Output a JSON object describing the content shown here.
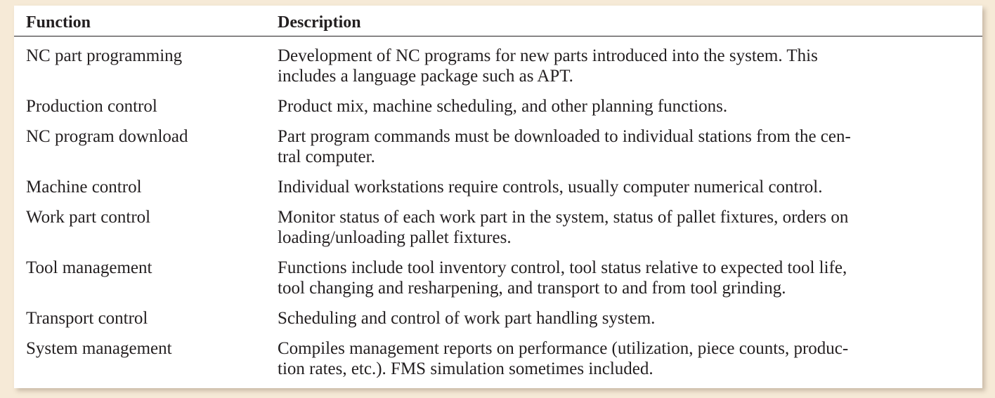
{
  "table": {
    "headers": {
      "function": "Function",
      "description": "Description"
    },
    "rows": [
      {
        "function": "NC part programming",
        "description_lines": [
          "Development of NC programs for new parts introduced into the system. This",
          "includes a language package such as APT."
        ]
      },
      {
        "function": "Production control",
        "description_lines": [
          "Product mix, machine scheduling, and other planning functions."
        ]
      },
      {
        "function": "NC program download",
        "description_lines": [
          "Part program commands must be downloaded to individual stations from the cen-",
          "tral computer."
        ]
      },
      {
        "function": "Machine control",
        "description_lines": [
          "Individual workstations require controls, usually computer numerical control."
        ]
      },
      {
        "function": "Work part control",
        "description_lines": [
          "Monitor status of each work part in the system, status of pallet fixtures, orders on",
          "loading/unloading pallet fixtures."
        ]
      },
      {
        "function": "Tool management",
        "description_lines": [
          "Functions include tool inventory control, tool status relative to expected tool life,",
          "tool changing and resharpening, and transport to and from tool grinding."
        ]
      },
      {
        "function": "Transport control",
        "description_lines": [
          "Scheduling and control of work part handling system."
        ]
      },
      {
        "function": "System management",
        "description_lines": [
          "Compiles management reports on performance (utilization, piece counts, produc-",
          "tion rates, etc.). FMS simulation sometimes included."
        ]
      }
    ]
  }
}
